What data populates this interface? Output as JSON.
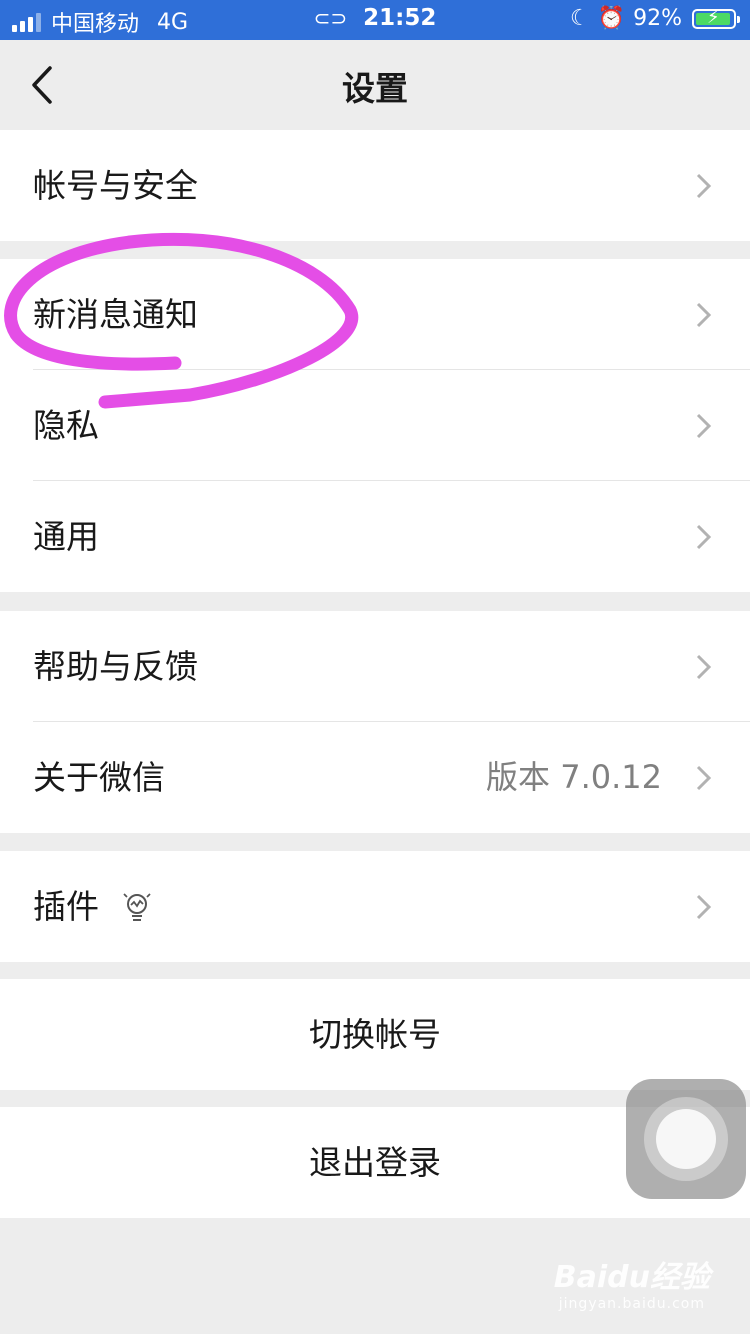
{
  "status_bar": {
    "carrier": "中国移动",
    "network": "4G",
    "time": "21:52",
    "battery": "92%",
    "icons": [
      "signal-icon",
      "link-icon",
      "moon-icon",
      "alarm-icon",
      "battery-charging-icon"
    ]
  },
  "nav": {
    "title": "设置",
    "back_icon": "back-chevron-icon"
  },
  "groups": {
    "account": {
      "items": [
        {
          "label": "帐号与安全"
        }
      ]
    },
    "main": {
      "items": [
        {
          "label": "新消息通知"
        },
        {
          "label": "隐私"
        },
        {
          "label": "通用"
        }
      ]
    },
    "support": {
      "items": [
        {
          "label": "帮助与反馈"
        },
        {
          "label": "关于微信",
          "value": "版本 7.0.12"
        }
      ]
    },
    "plugins": {
      "items": [
        {
          "label": "插件",
          "icon": "lightbulb-icon"
        }
      ]
    }
  },
  "switch_account": "切换帐号",
  "logout": "退出登录",
  "annotation": {
    "color": "#e44ee6",
    "target": "新消息通知"
  },
  "watermark": {
    "main": "Baidu经验",
    "sub": "jingyan.baidu.com"
  },
  "colors": {
    "status_bar": "#2f6fd8",
    "background": "#ededed",
    "chevron": "#b2b2b2",
    "battery_fill": "#4cd964"
  }
}
